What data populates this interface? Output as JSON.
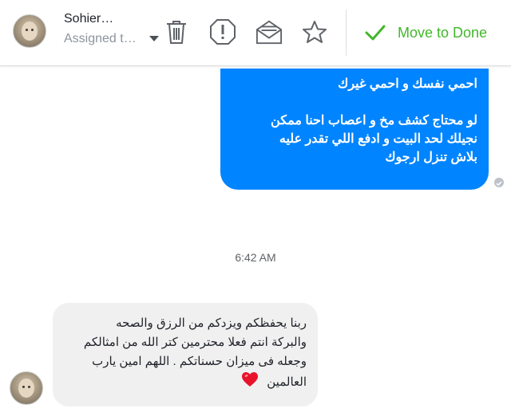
{
  "header": {
    "contact_name": "Sohier…",
    "assigned_text": "Assigned t…",
    "actions": {
      "delete": "trash-icon",
      "spam": "alert-icon",
      "mark_unread": "envelope-icon",
      "star": "star-icon"
    },
    "move_to_done_label": "Move to Done"
  },
  "conversation": {
    "outgoing": {
      "line1": "احمي نفسك و احمي غيرك",
      "line2": "لو محتاج كشف مخ و اعصاب احنا ممكن",
      "line3": "نجيلك لحد البيت و ادفع اللي تقدر عليه",
      "line4": "بلاش تنزل ارجوك"
    },
    "timestamp": "6:42 AM",
    "incoming": {
      "line1": "ربنا يحفظكم ويزدكم من الرزق والصحه",
      "line2": "والبركة انتم فعلا محترمين كتر الله من امثالكم",
      "line3": "وجعله فى ميزان حسناتكم . اللهم امين يارب",
      "line4": "العالمين",
      "emoji": "heart-icon"
    }
  },
  "colors": {
    "outgoing_bubble": "#0084ff",
    "incoming_bubble": "#f1f0f0",
    "done_green": "#42b72a",
    "heart_red": "#e8132b"
  }
}
